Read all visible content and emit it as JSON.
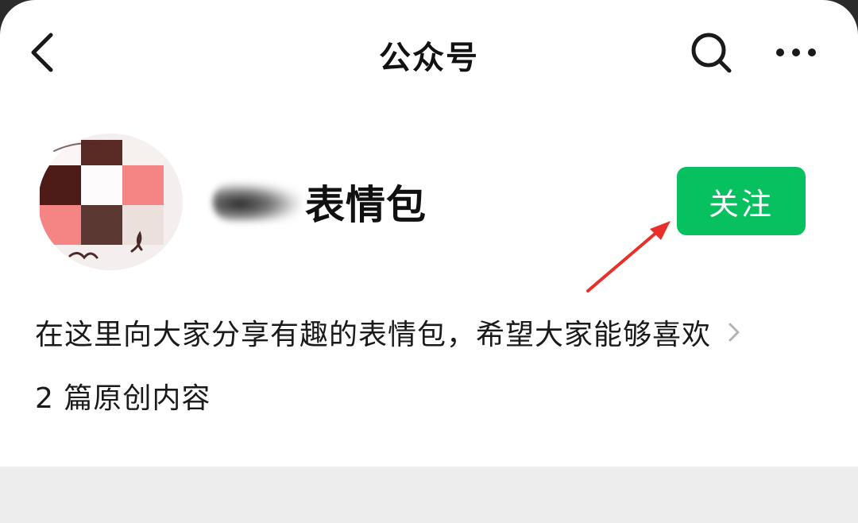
{
  "nav": {
    "title": "公众号",
    "back_icon": "chevron-left-icon",
    "search_icon": "search-icon",
    "more_icon": "more-horizontal-icon"
  },
  "profile": {
    "account_name": "表情包",
    "follow_label": "关注",
    "description": "在这里向大家分享有趣的表情包，希望大家能够喜欢",
    "original_count_text": "2 篇原创内容"
  },
  "colors": {
    "follow_button": "#07c160",
    "annotation_arrow": "#e8302a",
    "page_background": "#ffffff",
    "bottom_section": "#ededed"
  }
}
